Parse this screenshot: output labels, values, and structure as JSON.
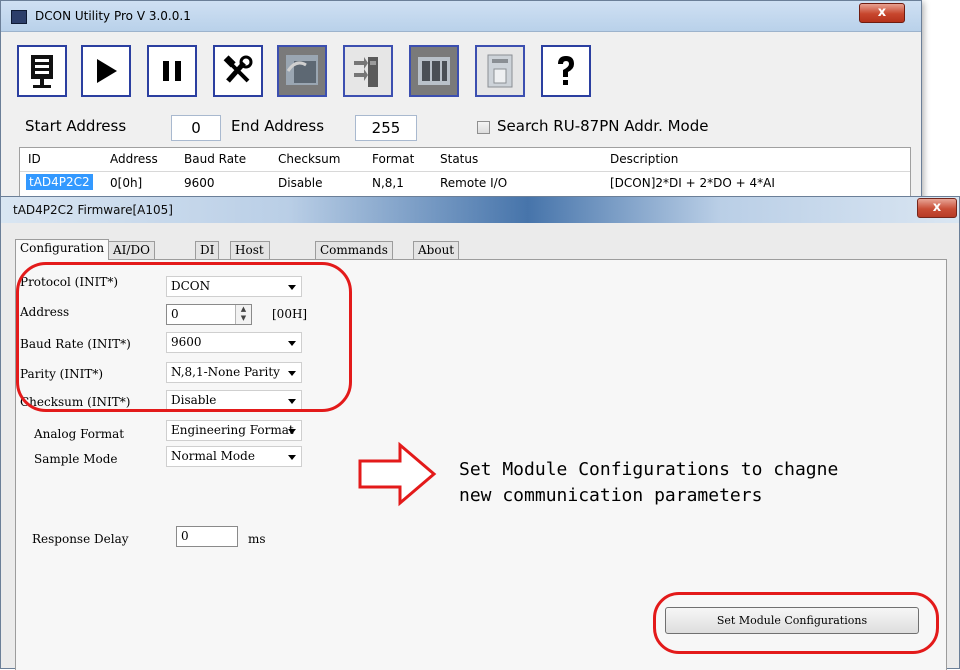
{
  "main_window": {
    "title": "DCON Utility Pro V 3.0.0.1",
    "close_glyph": "x",
    "toolbar": [
      {
        "icon": "search-module-icon"
      },
      {
        "icon": "play-icon"
      },
      {
        "icon": "pause-icon"
      },
      {
        "icon": "tools-icon"
      },
      {
        "icon": "module-config-icon"
      },
      {
        "icon": "io-module-icon"
      },
      {
        "icon": "device-rack-icon"
      },
      {
        "icon": "firmware-icon"
      },
      {
        "icon": "help-icon"
      }
    ],
    "start_address_label": "Start Address",
    "start_address_value": "0",
    "end_address_label": "End Address",
    "end_address_value": "255",
    "search_mode_label": "Search RU-87PN Addr. Mode",
    "table": {
      "columns": [
        "ID",
        "Address",
        "Baud Rate",
        "Checksum",
        "Format",
        "Status",
        "Description"
      ],
      "rows": [
        [
          "tAD4P2C2",
          "0[0h]",
          "9600",
          "Disable",
          "N,8,1",
          "Remote I/O",
          "[DCON]2*DI + 2*DO + 4*AI"
        ]
      ]
    }
  },
  "firmware_window": {
    "title": "tAD4P2C2 Firmware[A105]",
    "close_glyph": "x",
    "tabs": [
      "Configuration",
      "AI/DO Alarm",
      "DI",
      "Host WDT",
      "Commands Log",
      "About"
    ],
    "active_tab": "Configuration",
    "fields": {
      "protocol_label": "Protocol (INIT*)",
      "protocol_value": "DCON",
      "address_label": "Address",
      "address_value": "0",
      "address_hex": "[00H]",
      "baud_label": "Baud Rate (INIT*)",
      "baud_value": "9600",
      "parity_label": "Parity (INIT*)",
      "parity_value": "N,8,1-None Parity",
      "checksum_label": "Checksum (INIT*)",
      "checksum_value": "Disable",
      "analog_format_label": "Analog Format",
      "analog_format_value": "Engineering Format",
      "sample_mode_label": "Sample Mode",
      "sample_mode_value": "Normal Mode",
      "response_delay_label": "Response Delay",
      "response_delay_value": "0",
      "response_delay_unit": "ms"
    },
    "annotation_line1": "Set Module Configurations to chagne",
    "annotation_line2": "new communication parameters",
    "set_button_label": "Set Module Configurations",
    "highlight_color": "#e31a1a"
  }
}
